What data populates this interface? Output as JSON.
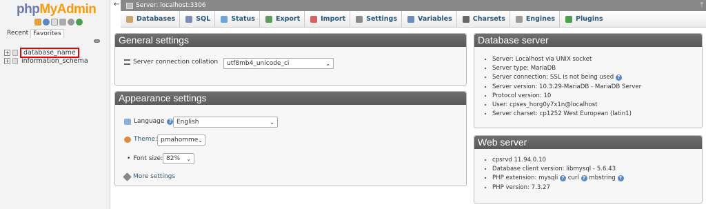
{
  "sidebar": {
    "logo_php": "php",
    "logo_my": "MyAdmin",
    "tabs": {
      "recent": "Recent",
      "favorites": "Favorites"
    },
    "databases": [
      "database_name",
      "information_schema"
    ]
  },
  "topbar": {
    "title": "Server: localhost:3306"
  },
  "menu": [
    {
      "label": "Databases",
      "icon": "database-icon",
      "color": "#c9a46a"
    },
    {
      "label": "SQL",
      "icon": "sql-icon",
      "color": "#7a8fb0"
    },
    {
      "label": "Status",
      "icon": "status-icon",
      "color": "#6fa3d6"
    },
    {
      "label": "Export",
      "icon": "export-icon",
      "color": "#5c9c5c"
    },
    {
      "label": "Import",
      "icon": "import-icon",
      "color": "#d86060"
    },
    {
      "label": "Settings",
      "icon": "settings-icon",
      "color": "#8a8a8a"
    },
    {
      "label": "Variables",
      "icon": "variables-icon",
      "color": "#6a8cbc"
    },
    {
      "label": "Charsets",
      "icon": "charsets-icon",
      "color": "#666666"
    },
    {
      "label": "Engines",
      "icon": "engines-icon",
      "color": "#9a9a9a"
    },
    {
      "label": "Plugins",
      "icon": "plugins-icon",
      "color": "#4aa04a"
    }
  ],
  "general": {
    "title": "General settings",
    "collation_label": "Server connection collation",
    "collation_value": "utf8mb4_unicode_ci"
  },
  "appearance": {
    "title": "Appearance settings",
    "language_label": "Language",
    "language_value": "English",
    "theme_label": "Theme:",
    "theme_value": "pmahomme",
    "fontsize_label": "Font size:",
    "fontsize_value": "82%",
    "more_settings": "More settings"
  },
  "db_server": {
    "title": "Database server",
    "items": [
      "Server: Localhost via UNIX socket",
      "Server type: MariaDB",
      "Server connection: SSL is not being used",
      "Server version: 10.3.29-MariaDB - MariaDB Server",
      "Protocol version: 10",
      "User: cpses_horg0y7x1n@localhost",
      "Server charset: cp1252 West European (latin1)"
    ]
  },
  "web_server": {
    "title": "Web server",
    "items": [
      "cpsrvd 11.94.0.10",
      "Database client version: libmysql - 5.6.43",
      "PHP version: 7.3.27"
    ],
    "php_ext_label": "PHP extension: mysqli",
    "php_ext_curl": "curl",
    "php_ext_mbstring": "mbstring"
  }
}
